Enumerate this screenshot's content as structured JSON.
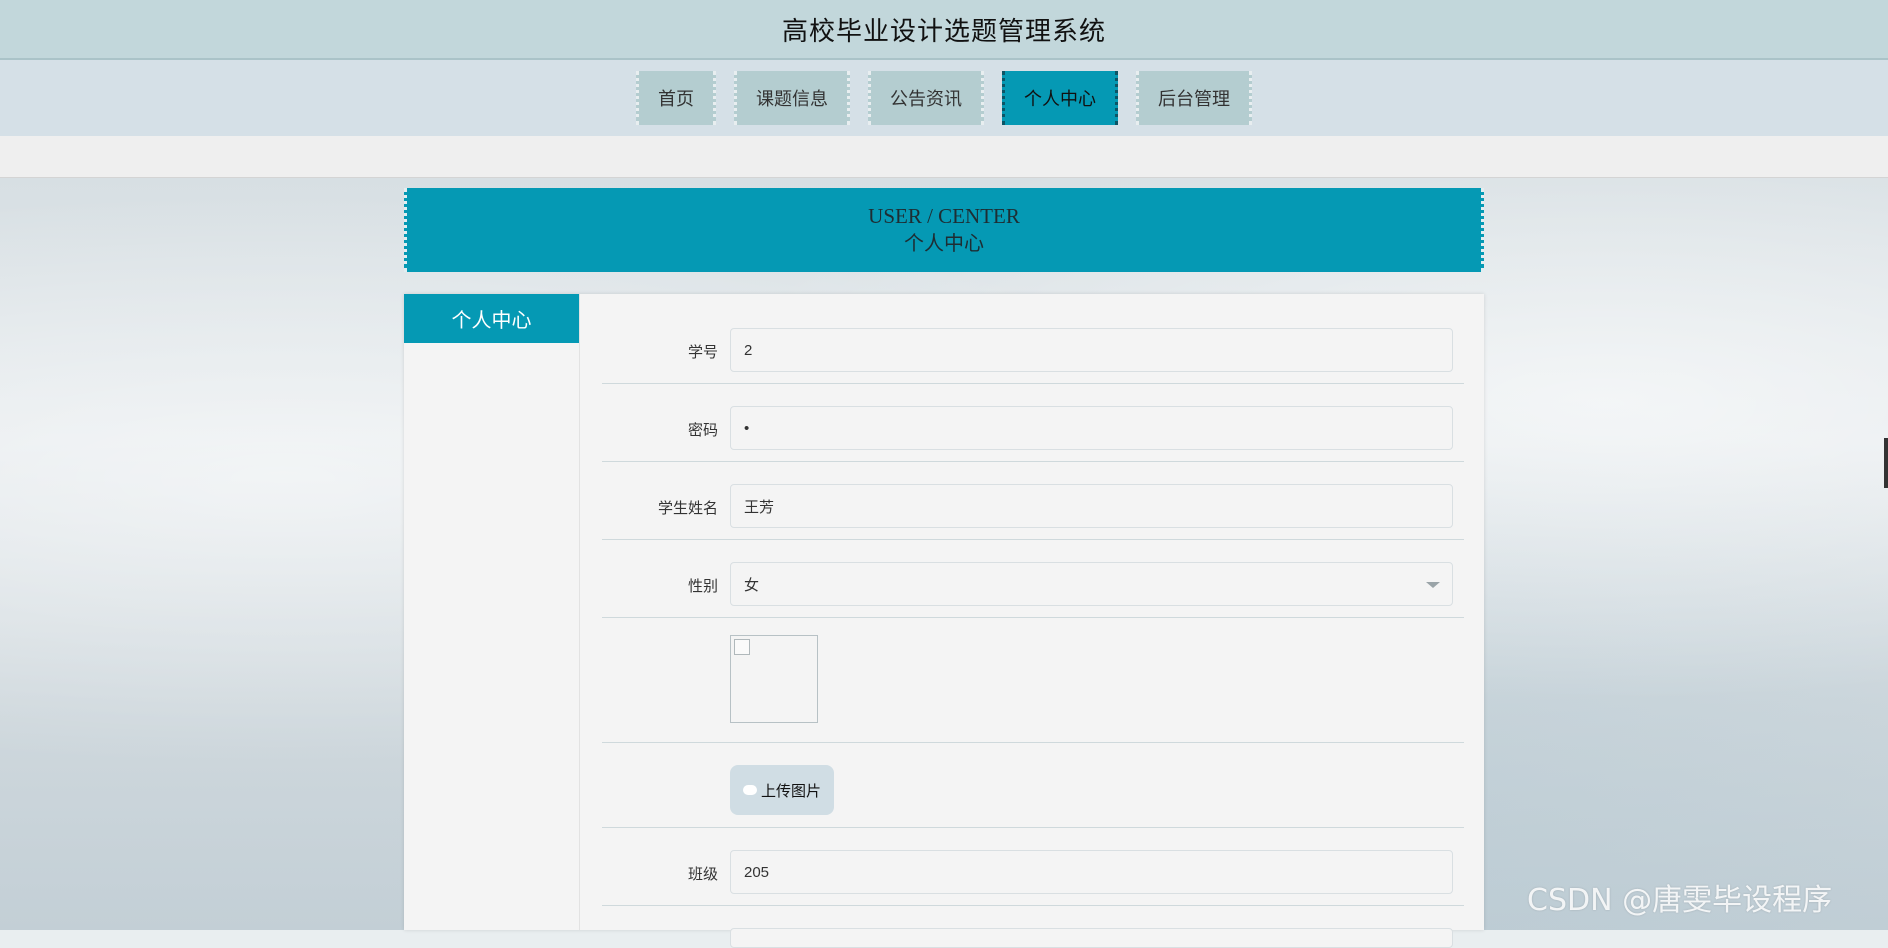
{
  "header": {
    "title": "高校毕业设计选题管理系统"
  },
  "nav": {
    "items": [
      {
        "label": "首页"
      },
      {
        "label": "课题信息"
      },
      {
        "label": "公告资讯"
      },
      {
        "label": "个人中心"
      },
      {
        "label": "后台管理"
      }
    ],
    "active": "个人中心"
  },
  "banner": {
    "en": "USER / CENTER",
    "cn": "个人中心"
  },
  "sidebar": {
    "items": [
      {
        "label": "个人中心"
      }
    ]
  },
  "form": {
    "student_id": {
      "label": "学号",
      "value": "2"
    },
    "password": {
      "label": "密码",
      "value": "•"
    },
    "student_name": {
      "label": "学生姓名",
      "value": "王芳"
    },
    "gender": {
      "label": "性别",
      "value": "女"
    },
    "upload_button": {
      "label": "上传图片",
      "icon": "cloud-upload-icon"
    },
    "class": {
      "label": "班级",
      "value": "205"
    }
  },
  "watermark": {
    "text": "CSDN @唐雯毕设程序"
  },
  "colors": {
    "accent": "#0599b4",
    "topbar": "#c2d7db",
    "nav_item": "#b4cdd0"
  }
}
